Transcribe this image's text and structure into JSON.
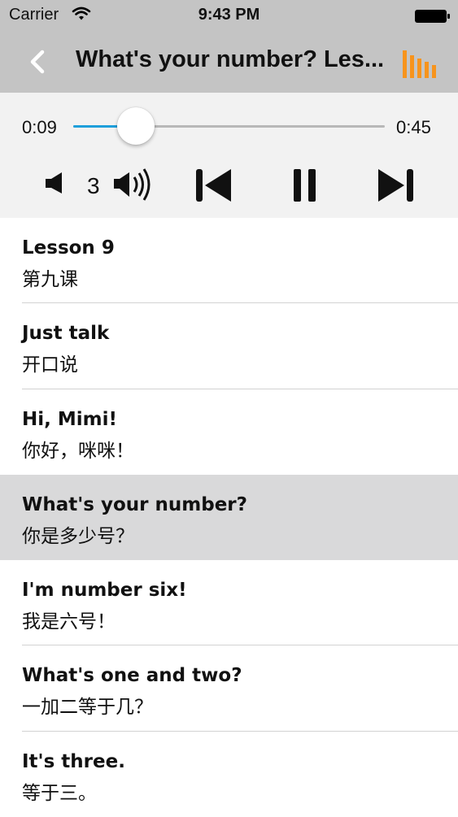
{
  "status_bar": {
    "carrier": "Carrier",
    "time": "9:43 PM",
    "icons": [
      "wifi-icon",
      "battery-icon"
    ]
  },
  "nav": {
    "back_icon": "back-chevron-icon",
    "title": "What's your number? Les...",
    "right_icon": "equalizer-bars-icon",
    "accent_color": "#f7941d"
  },
  "player": {
    "elapsed": "0:09",
    "total": "0:45",
    "progress": 0.2,
    "progress_color": "#1e9fdb",
    "volume_level": "3",
    "controls": [
      "volume-down-icon",
      "volume-up-icon",
      "skip-previous-icon",
      "pause-icon",
      "skip-next-icon"
    ]
  },
  "lessons": [
    {
      "en": "Lesson 9",
      "zh": "第九课",
      "selected": false
    },
    {
      "en": "Just talk",
      "zh": "开口说",
      "selected": false
    },
    {
      "en": "Hi, Mimi!",
      "zh": "你好，咪咪！",
      "selected": false
    },
    {
      "en": "What's your number?",
      "zh": "你是多少号？",
      "selected": true
    },
    {
      "en": "I'm number six!",
      "zh": "我是六号！",
      "selected": false
    },
    {
      "en": "What's one and two?",
      "zh": "一加二等于几？",
      "selected": false
    },
    {
      "en": "It's three.",
      "zh": "等于三。",
      "selected": false
    }
  ]
}
